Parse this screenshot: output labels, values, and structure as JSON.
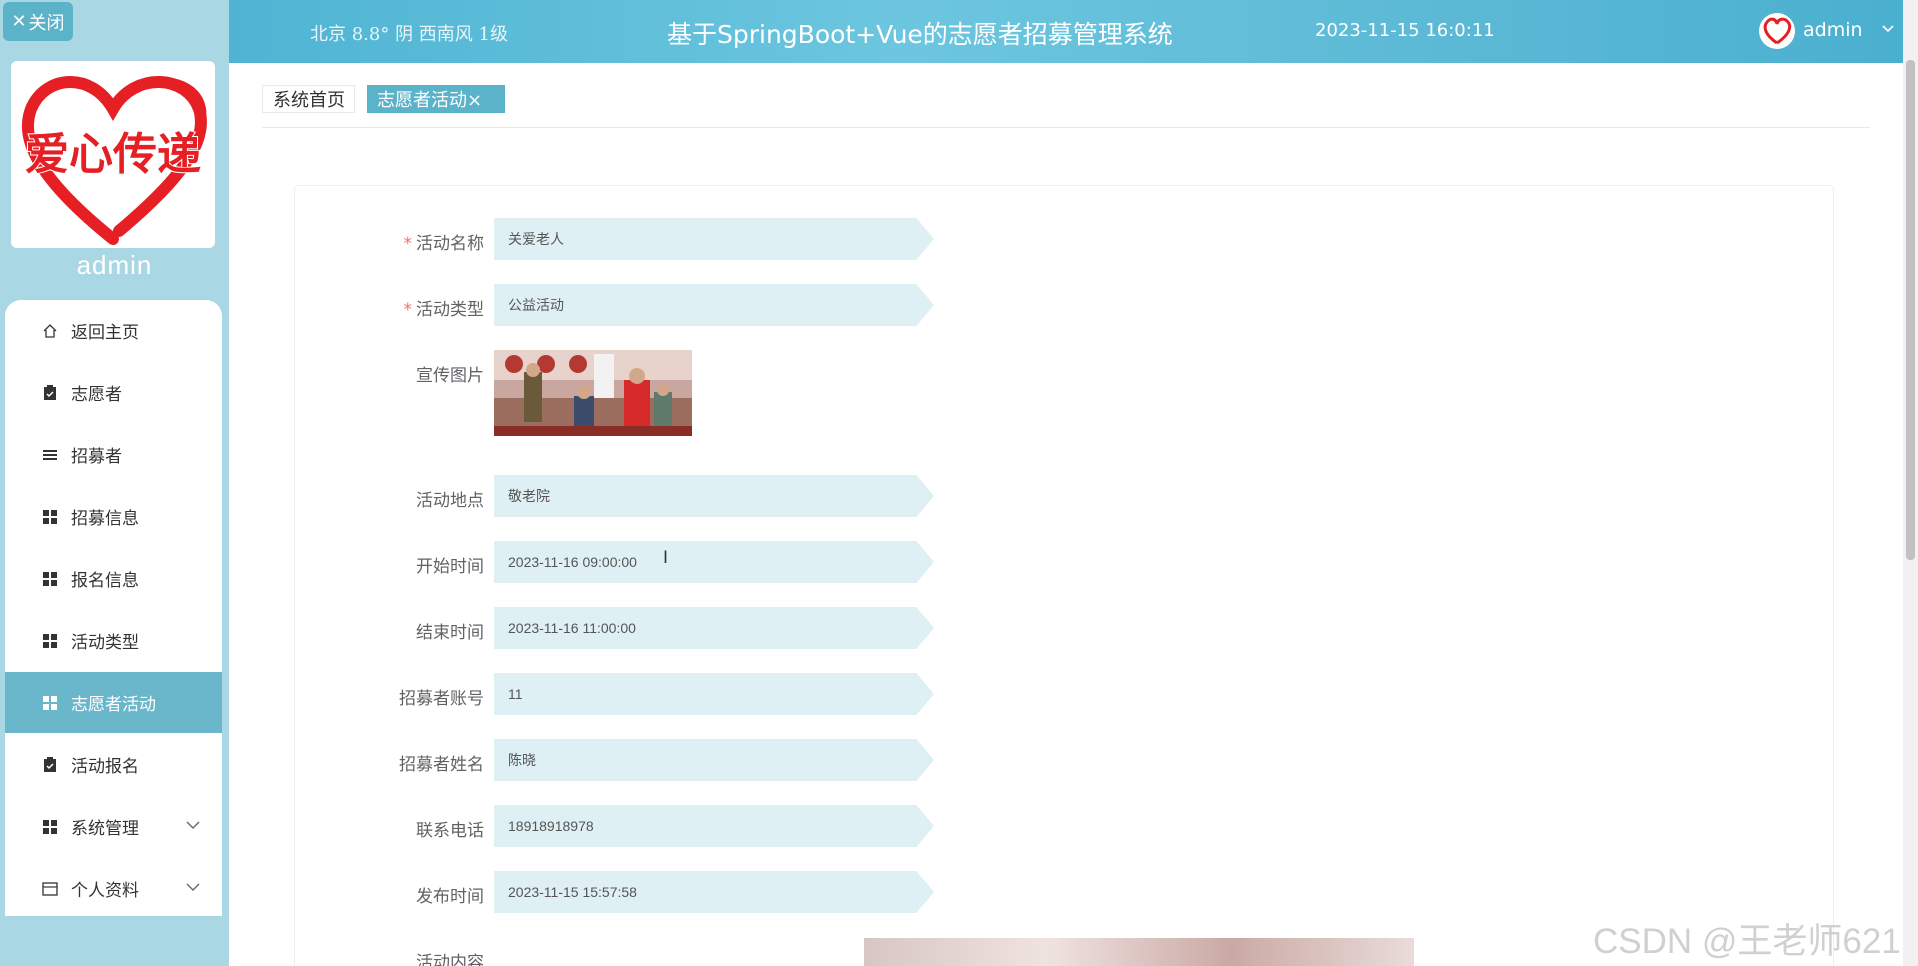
{
  "sidebar": {
    "close_label": "关闭",
    "logo_text": "爱心传递",
    "username": "admin",
    "items": [
      {
        "label": "返回主页",
        "icon": "home-icon"
      },
      {
        "label": "志愿者",
        "icon": "clipboard-icon"
      },
      {
        "label": "招募者",
        "icon": "list-icon"
      },
      {
        "label": "招募信息",
        "icon": "grid-icon"
      },
      {
        "label": "报名信息",
        "icon": "grid-icon"
      },
      {
        "label": "活动类型",
        "icon": "grid-icon"
      },
      {
        "label": "志愿者活动",
        "icon": "grid-icon",
        "active": true
      },
      {
        "label": "活动报名",
        "icon": "clipboard-icon"
      },
      {
        "label": "系统管理",
        "icon": "grid-icon",
        "has_submenu": true
      },
      {
        "label": "个人资料",
        "icon": "card-icon",
        "has_submenu": true
      }
    ]
  },
  "header": {
    "weather": "北京 8.8° 阴 西南风 1级",
    "title": "基于SpringBoot+Vue的志愿者招募管理系统",
    "datetime": "2023-11-15 16:0:11",
    "username": "admin"
  },
  "tabs": {
    "home": "系统首页",
    "active": "志愿者活动×"
  },
  "form": {
    "activity_name": {
      "label": "活动名称",
      "value": "关爱老人",
      "required": true
    },
    "activity_type": {
      "label": "活动类型",
      "value": "公益活动",
      "required": true
    },
    "promo_image": {
      "label": "宣传图片"
    },
    "location": {
      "label": "活动地点",
      "value": "敬老院"
    },
    "start_time": {
      "label": "开始时间",
      "value": "2023-11-16 09:00:00"
    },
    "end_time": {
      "label": "结束时间",
      "value": "2023-11-16 11:00:00"
    },
    "recruiter_account": {
      "label": "招募者账号",
      "value": "11"
    },
    "recruiter_name": {
      "label": "招募者姓名",
      "value": "陈晓"
    },
    "phone": {
      "label": "联系电话",
      "value": "18918918978"
    },
    "publish_time": {
      "label": "发布时间",
      "value": "2023-11-15 15:57:58"
    },
    "content": {
      "label": "活动内容"
    }
  },
  "watermark": "CSDN @王老师621",
  "colors": {
    "header": "#5dbad6",
    "sidebar": "#a9d7e3",
    "accent": "#5bb3c9",
    "input_bg": "#dff0f4",
    "required": "#f56c6c"
  }
}
